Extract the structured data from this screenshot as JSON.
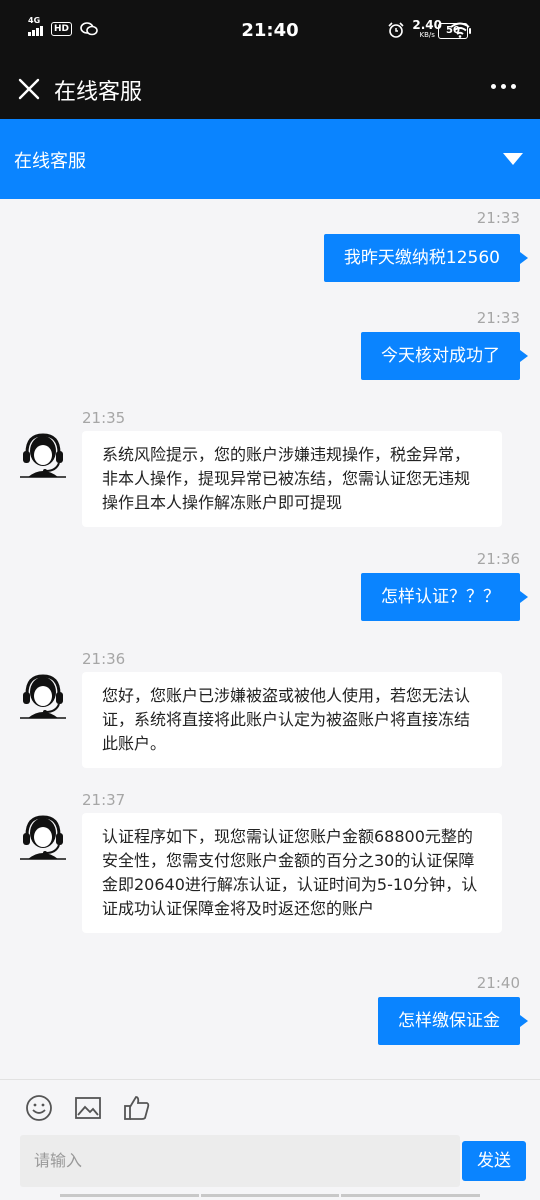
{
  "status_bar": {
    "network": "4G",
    "hd_badge": "HD",
    "time": "21:40",
    "speed_value": "2.40",
    "speed_unit": "KB/s",
    "battery": "50"
  },
  "title_bar": {
    "title": "在线客服"
  },
  "service_header": {
    "title": "在线客服"
  },
  "messages": [
    {
      "side": "out",
      "time": "21:33",
      "text": "我昨天缴纳税12560"
    },
    {
      "side": "out",
      "time": "21:33",
      "text": "今天核对成功了"
    },
    {
      "side": "in",
      "time": "21:35",
      "text": "系统风险提示，您的账户涉嫌违规操作，税金异常，非本人操作，提现异常已被冻结，您需认证您无违规操作且本人操作解冻账户即可提现"
    },
    {
      "side": "out",
      "time": "21:36",
      "text": "怎样认证？？？"
    },
    {
      "side": "in",
      "time": "21:36",
      "text": "您好，您账户已涉嫌被盗或被他人使用，若您无法认证，系统将直接将此账户认定为被盗账户将直接冻结此账户。"
    },
    {
      "side": "in",
      "time": "21:37",
      "text": "认证程序如下，现您需认证您账户金额68800元整的安全性，您需支付您账户金额的百分之30的认证保障金即20640进行解冻认证，认证时间为5-10分钟，认证成功认证保障金将及时返还您的账户"
    },
    {
      "side": "out",
      "time": "21:40",
      "text": "怎样缴保证金"
    }
  ],
  "input": {
    "placeholder": "请输入",
    "send_label": "发送"
  },
  "icons": [
    "close-icon",
    "more-icon",
    "dropdown-arrow-icon",
    "emoji-icon",
    "image-icon",
    "thumbs-up-icon",
    "customer-service-avatar-icon"
  ],
  "colors": {
    "accent": "#0a84ff",
    "dark_bar": "#111111",
    "background": "#f5f5f7"
  }
}
